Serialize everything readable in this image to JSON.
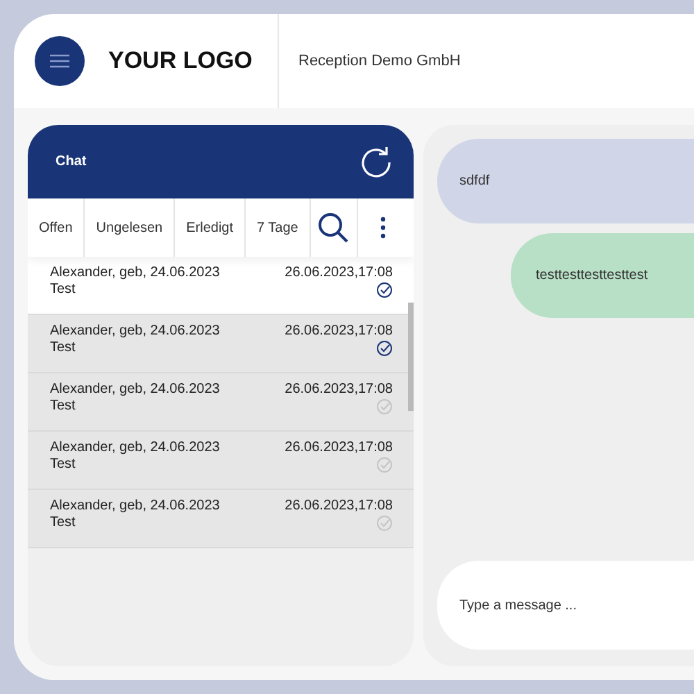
{
  "header": {
    "logo": "YOUR LOGO",
    "company": "Reception Demo GmbH"
  },
  "chat_panel": {
    "title": "Chat",
    "filters": [
      {
        "label": "Offen"
      },
      {
        "label": "Ungelesen"
      },
      {
        "label": "Erledigt"
      },
      {
        "label": "7 Tage"
      }
    ],
    "conversations": [
      {
        "name": "Alexander, geb, 24.06.2023",
        "subject": "Test",
        "time": "26.06.2023,17:08",
        "read": true,
        "selected": true
      },
      {
        "name": "Alexander, geb, 24.06.2023",
        "subject": "Test",
        "time": "26.06.2023,17:08",
        "read": true,
        "selected": false
      },
      {
        "name": "Alexander, geb, 24.06.2023",
        "subject": "Test",
        "time": "26.06.2023,17:08",
        "read": false,
        "selected": false
      },
      {
        "name": "Alexander, geb, 24.06.2023",
        "subject": "Test",
        "time": "26.06.2023,17:08",
        "read": false,
        "selected": false
      },
      {
        "name": "Alexander, geb, 24.06.2023",
        "subject": "Test",
        "time": "26.06.2023,17:08",
        "read": false,
        "selected": false
      }
    ]
  },
  "messages": [
    {
      "text": "sdfdf",
      "kind": "incoming"
    },
    {
      "text": "testtesttesttesttest",
      "kind": "outgoing"
    }
  ],
  "composer": {
    "placeholder": "Type a message ..."
  }
}
